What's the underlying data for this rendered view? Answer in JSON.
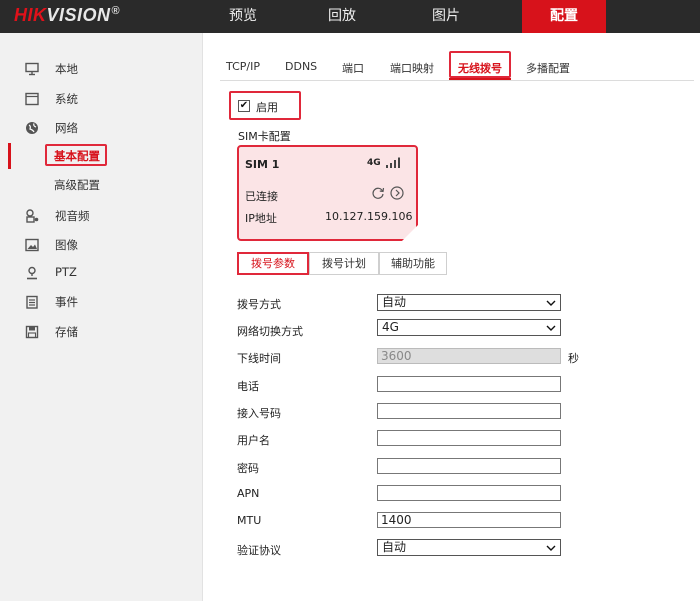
{
  "brand": {
    "hik": "HIK",
    "vision": "VISION",
    "reg": "®"
  },
  "top_nav": [
    "预览",
    "回放",
    "图片",
    "配置"
  ],
  "sidebar": {
    "items": [
      {
        "label": "本地",
        "icon": "monitor-icon"
      },
      {
        "label": "系统",
        "icon": "system-icon"
      },
      {
        "label": "网络",
        "icon": "globe-icon"
      },
      {
        "label": "视音频",
        "icon": "audio-video-icon"
      },
      {
        "label": "图像",
        "icon": "image-icon"
      },
      {
        "label": "PTZ",
        "icon": "ptz-icon"
      },
      {
        "label": "事件",
        "icon": "event-icon"
      },
      {
        "label": "存储",
        "icon": "storage-icon"
      }
    ],
    "network_sub": [
      "基本配置",
      "高级配置"
    ]
  },
  "subtabs": [
    "TCP/IP",
    "DDNS",
    "端口",
    "端口映射",
    "无线拨号",
    "多播配置"
  ],
  "enable_label": "启用",
  "enable_checked": "✔",
  "sim_section_label": "SIM卡配置",
  "sim": {
    "title": "SIM 1",
    "network": "4G",
    "status": "已连接",
    "ip_label": "IP地址",
    "ip_value": "10.127.159.106"
  },
  "inner_tabs": [
    "拨号参数",
    "拨号计划",
    "辅助功能"
  ],
  "form": {
    "dial_mode": {
      "label": "拨号方式",
      "value": "自动"
    },
    "net_switch": {
      "label": "网络切换方式",
      "value": "4G"
    },
    "offline_time": {
      "label": "下线时间",
      "value": "3600",
      "unit": "秒"
    },
    "phone": {
      "label": "电话",
      "value": ""
    },
    "access_number": {
      "label": "接入号码",
      "value": ""
    },
    "username": {
      "label": "用户名",
      "value": ""
    },
    "password": {
      "label": "密码",
      "value": ""
    },
    "apn": {
      "label": "APN",
      "value": ""
    },
    "mtu": {
      "label": "MTU",
      "value": "1400"
    },
    "auth": {
      "label": "验证协议",
      "value": "自动"
    }
  },
  "colors": {
    "accent": "#d7121b",
    "topbar": "#2a2a2a",
    "sidebar_bg": "#f1f1f1",
    "sim_bg": "#fbe4e6"
  }
}
